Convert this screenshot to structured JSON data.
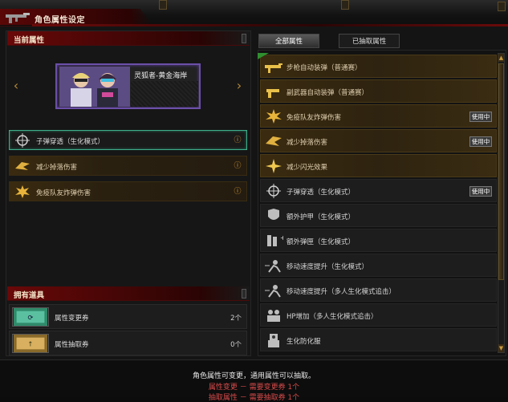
{
  "window": {
    "title": "角色属性设定"
  },
  "left_panel": {
    "current_section_label": "当前属性",
    "character_name": "灵狐者-黄金海岸",
    "slots": [
      {
        "label": "子弹穿透（生化模式）",
        "icon": "crosshair-icon",
        "selected": true
      },
      {
        "label": "减少掉落伤害",
        "icon": "wing-icon",
        "selected": false
      },
      {
        "label": "免疫队友炸弹伤害",
        "icon": "explosion-icon",
        "selected": false
      }
    ],
    "inventory_section_label": "拥有道具",
    "inventory": [
      {
        "label": "属性变更券",
        "count": "2个",
        "icon": "change-ticket-icon"
      },
      {
        "label": "属性抽取券",
        "count": "0个",
        "icon": "extract-ticket-icon"
      }
    ]
  },
  "right_panel": {
    "tabs": [
      {
        "label": "全部属性",
        "active": true
      },
      {
        "label": "已抽取属性",
        "active": false
      }
    ],
    "attributes": [
      {
        "label": "步枪自动装弹（普通赛）",
        "style": "gold",
        "icon": "rifle-icon",
        "badge": ""
      },
      {
        "label": "副武器自动装弹（普通赛）",
        "style": "gold",
        "icon": "pistol-icon",
        "badge": ""
      },
      {
        "label": "免疫队友炸弹伤害",
        "style": "gold",
        "icon": "explosion-icon",
        "badge": "使用中"
      },
      {
        "label": "减少掉落伤害",
        "style": "gold",
        "icon": "wing-icon",
        "badge": "使用中"
      },
      {
        "label": "减少闪光效果",
        "style": "gold",
        "icon": "flash-icon",
        "badge": ""
      },
      {
        "label": "子弹穿透（生化模式）",
        "style": "plain",
        "icon": "crosshair-icon",
        "badge": "使用中"
      },
      {
        "label": "额外护甲（生化模式）",
        "style": "plain",
        "icon": "armor-icon",
        "badge": ""
      },
      {
        "label": "额外弹匣（生化模式）",
        "style": "plain",
        "icon": "magazine-icon",
        "badge": ""
      },
      {
        "label": "移动速度提升（生化模式）",
        "style": "plain",
        "icon": "speed-icon",
        "badge": ""
      },
      {
        "label": "移动速度提升（多人生化模式追击）",
        "style": "plain",
        "icon": "speed-icon",
        "badge": ""
      },
      {
        "label": "HP增加（多人生化模式追击）",
        "style": "plain",
        "icon": "hp-icon",
        "badge": ""
      },
      {
        "label": "生化防化服",
        "style": "plain",
        "icon": "hazmat-icon",
        "badge": ""
      }
    ]
  },
  "footer": {
    "line1": "角色属性可变更，通用属性可以抽取。",
    "line2": "属性变更 － 需要变更券 1个",
    "line3": "抽取属性 － 需要抽取券 1个"
  },
  "colors": {
    "accent_red": "#6a0808",
    "gold_row": "#3a2b10",
    "selected_border": "#3fae8a",
    "footer_red": "#d84a4a"
  }
}
